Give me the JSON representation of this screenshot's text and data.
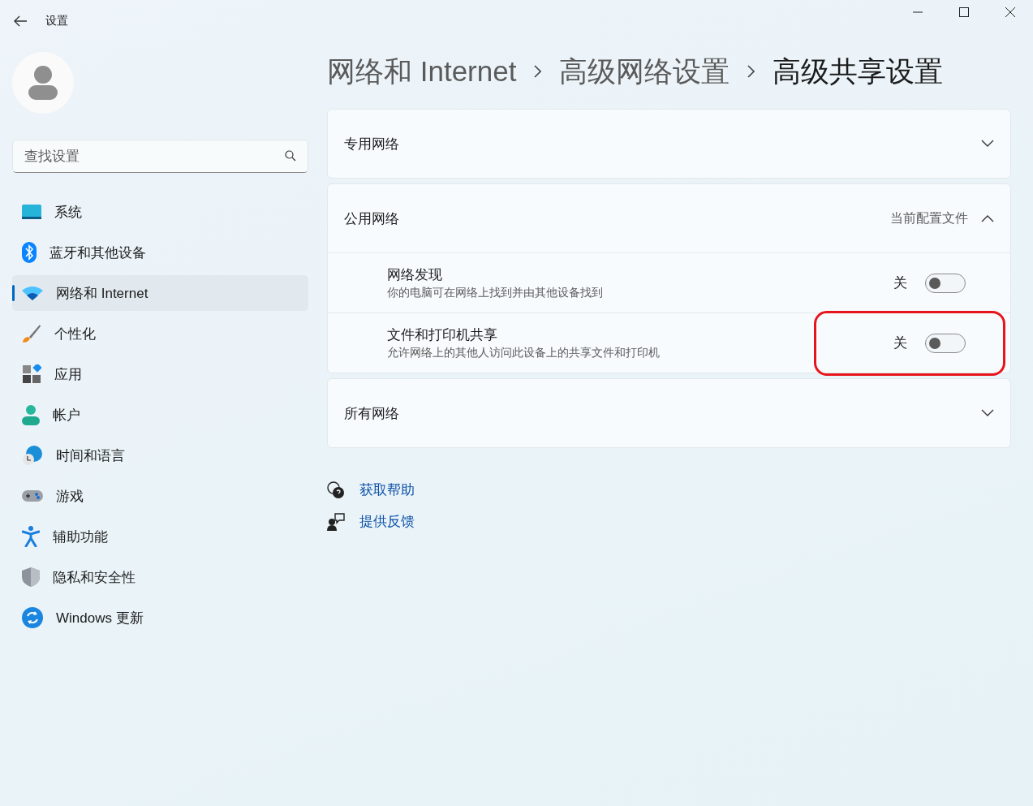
{
  "window": {
    "title": "设置"
  },
  "sidebar": {
    "search": {
      "placeholder": "查找设置"
    },
    "items": [
      {
        "label": "系统",
        "selected": false
      },
      {
        "label": "蓝牙和其他设备",
        "selected": false
      },
      {
        "label": "网络和 Internet",
        "selected": true
      },
      {
        "label": "个性化",
        "selected": false
      },
      {
        "label": "应用",
        "selected": false
      },
      {
        "label": "帐户",
        "selected": false
      },
      {
        "label": "时间和语言",
        "selected": false
      },
      {
        "label": "游戏",
        "selected": false
      },
      {
        "label": "辅助功能",
        "selected": false
      },
      {
        "label": "隐私和安全性",
        "selected": false
      },
      {
        "label": "Windows 更新",
        "selected": false
      }
    ]
  },
  "breadcrumb": [
    "网络和 Internet",
    "高级网络设置",
    "高级共享设置"
  ],
  "sections": [
    {
      "title": "专用网络",
      "expanded": false
    },
    {
      "title": "公用网络",
      "note": "当前配置文件",
      "expanded": true,
      "settings": [
        {
          "title": "网络发现",
          "description": "你的电脑可在网络上找到并由其他设备找到",
          "state_label": "关",
          "on": false,
          "highlighted": false
        },
        {
          "title": "文件和打印机共享",
          "description": "允许网络上的其他人访问此设备上的共享文件和打印机",
          "state_label": "关",
          "on": false,
          "highlighted": true
        }
      ]
    },
    {
      "title": "所有网络",
      "expanded": false
    }
  ],
  "links": [
    "获取帮助",
    "提供反馈"
  ]
}
